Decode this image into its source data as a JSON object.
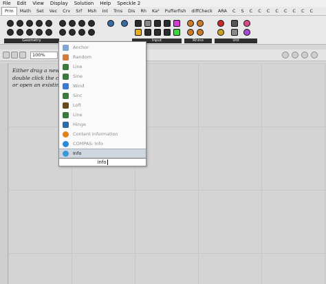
{
  "menu": [
    "File",
    "Edit",
    "View",
    "Display",
    "Solution",
    "Help",
    "Speckle 2"
  ],
  "tabs": [
    "Prm",
    "Math",
    "Set",
    "Vec",
    "Crv",
    "Srf",
    "Msh",
    "Int",
    "Trns",
    "Dis",
    "Rh",
    "Ka²",
    "Pufferfish",
    "diffCheck",
    "ARA",
    "C",
    "S",
    "C",
    "C",
    "C",
    "C",
    "C",
    "C",
    "C",
    "C"
  ],
  "active_tab": "Prm",
  "ribbon_panels": [
    "Geometry",
    "Input",
    "Rhino",
    "Util"
  ],
  "zoom": "100%",
  "hint_lines": [
    "Either drag a new c",
    "double click the ca",
    "or open an existing"
  ],
  "popup_items": [
    {
      "label": "Anchor",
      "icon": "anchor-icon",
      "color": "#7fa6d6"
    },
    {
      "label": "Random",
      "icon": "dice-icon",
      "color": "#d67a3a"
    },
    {
      "label": "Line",
      "icon": "line-icon",
      "color": "#3a7a3a"
    },
    {
      "label": "Sine",
      "icon": "sine-icon",
      "color": "#3a7a3a"
    },
    {
      "label": "Wind",
      "icon": "wind-icon",
      "color": "#3a7ad6"
    },
    {
      "label": "Sinc",
      "icon": "sinc-icon",
      "color": "#3a7a3a"
    },
    {
      "label": "Loft",
      "icon": "loft-icon",
      "color": "#6a4a1a"
    },
    {
      "label": "Line",
      "icon": "line-icon",
      "color": "#3a7a3a"
    },
    {
      "label": "Hinge",
      "icon": "hinge-icon",
      "color": "#2a6aa6"
    },
    {
      "label": "Content Information",
      "icon": "info-icon",
      "color": "#e0841a"
    },
    {
      "label": "COMPAS: Info",
      "icon": "compas-icon",
      "color": "#2a8ad6"
    },
    {
      "label": "Info",
      "icon": "globe-icon",
      "color": "#3a9ad6"
    }
  ],
  "selected_item": "Info",
  "search_value": "info"
}
